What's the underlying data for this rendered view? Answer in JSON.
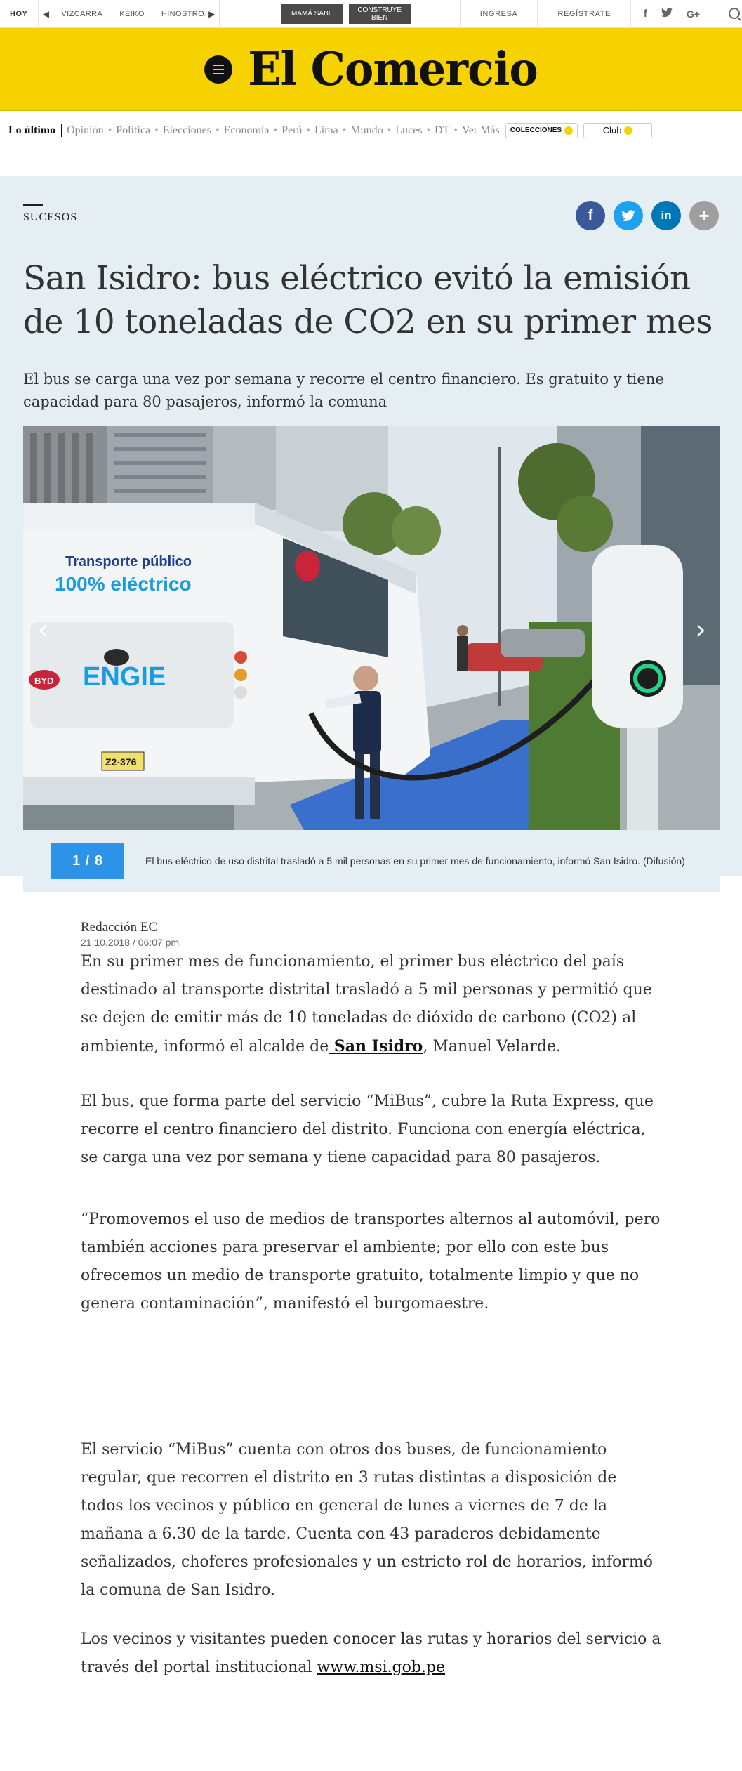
{
  "topbar": {
    "hoy": "HOY",
    "tags": [
      "VIZCARRA",
      "KEIKO",
      "HINOSTROZA"
    ],
    "specials": [
      "MAMÁ SABE",
      "CONSTRUYE BIEN"
    ],
    "login": "INGRESA",
    "register": "REGÍSTRATE",
    "social_icons": [
      "facebook-icon",
      "twitter-icon",
      "google-plus-icon"
    ]
  },
  "brand": {
    "logo": "El Comercio",
    "color": "#f6d200"
  },
  "nav": {
    "first": "Lo último",
    "items": [
      "Opinión",
      "Política",
      "Elecciones",
      "Economía",
      "Perú",
      "Lima",
      "Mundo",
      "Luces",
      "DT",
      "Ver Más"
    ],
    "colecciones": "COLECCIONES",
    "club": "Club"
  },
  "article": {
    "section": "SUCESOS",
    "title": "San Isidro: bus eléctrico evitó la emisión de 10 toneladas de CO2 en su primer mes",
    "subtitle": "El bus se carga una vez por semana y recorre el centro financiero. Es gratuito y tiene capacidad para 80 pasajeros, informó la comuna",
    "gallery": {
      "counter": "1 / 8",
      "caption": "El bus eléctrico de uso distrital trasladó a 5 mil personas en su primer mes de funcionamiento, informó San Isidro. (Difusión)",
      "bus_text_1": "Transporte público",
      "bus_text_2": "100% eléctrico",
      "bus_brand": "ENGIE",
      "bus_maker": "BYD",
      "plate": "Z2-376"
    },
    "author": "Redacción EC",
    "date": "21.10.2018 / 06:07 pm",
    "p1_before": "En su primer mes de funcionamiento, el primer bus eléctrico del país destinado al transporte distrital trasladó a 5 mil personas y permitió que se dejen de emitir más de 10 toneladas de dióxido de carbono (CO2) al ambiente, informó el alcalde de",
    "p1_link": " San Isidro",
    "p1_after": ", Manuel Velarde.",
    "p2": "El bus, que forma parte del servicio “MiBus”, cubre la Ruta Express, que recorre el centro financiero del distrito. Funciona con energía eléctrica, se carga una vez por semana y tiene capacidad para 80 pasajeros.",
    "p3": "“Promovemos el uso de medios de transportes alternos al automóvil, pero también acciones para preservar el ambiente; por ello con este bus ofrecemos un medio de transporte gratuito, totalmente limpio y que no genera contaminación”, manifestó el burgomaestre.",
    "p4": "El servicio “MiBus” cuenta con otros dos buses, de funcionamiento regular, que recorren el distrito en 3 rutas distintas a disposición de todos los vecinos y público en general de lunes a viernes de 7 de la mañana a 6.30 de la tarde. Cuenta con 43 paraderos debidamente señalizados, choferes profesionales y un estricto rol de horarios, informó la comuna de San Isidro.",
    "p5_before": "Los vecinos y visitantes pueden conocer las rutas y horarios del servicio a través del portal institucional ",
    "p5_link": "www.msi.gob.pe"
  }
}
